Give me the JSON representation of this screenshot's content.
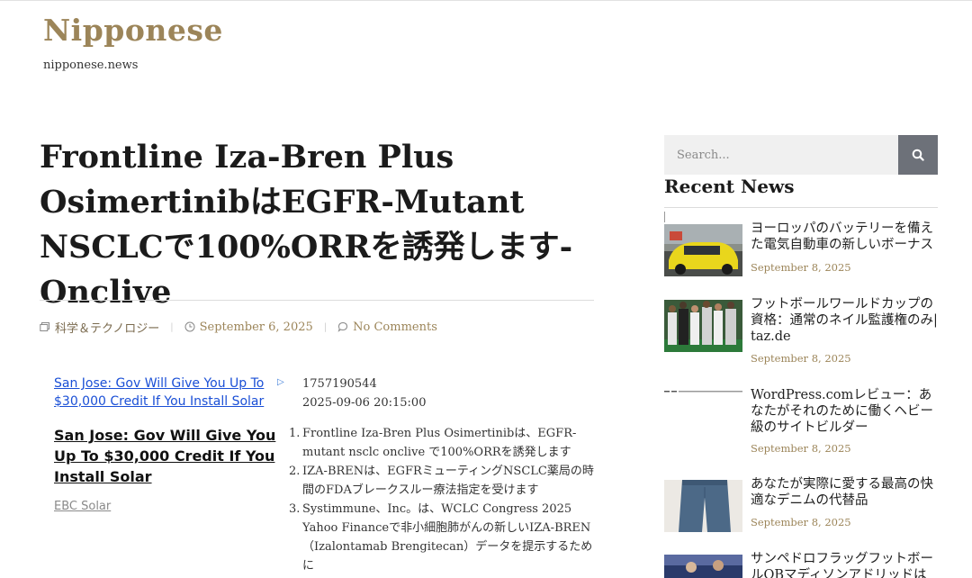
{
  "site": {
    "title": "Nipponese",
    "tagline": "nipponese.news"
  },
  "post": {
    "title": "Frontline Iza-Bren Plus OsimertinibはEGFR-Mutant NSCLCで100%ORRを誘発します-Onclive",
    "category": "科学＆テクノロジー",
    "date": "September 6, 2025",
    "comments": "No Comments"
  },
  "ad": {
    "image_alt": "San Jose: Gov Will Give You Up To $30,000 Credit If You Install Solar",
    "marker": "▷",
    "headline": "San Jose: Gov Will Give You Up To $30,000 Credit If You Install Solar",
    "source": "EBC Solar"
  },
  "body": {
    "id_line": "1757190544",
    "timestamp": "2025-09-06 20:15:00",
    "points": [
      {
        "num": "1.",
        "text": "Frontline Iza-Bren Plus Osimertinibは、EGFR-mutant nsclc onclive で100%ORRを誘発します"
      },
      {
        "num": "2.",
        "text": "IZA-BRENは、EGFRミューティングNSCLC薬局の時間のFDAブレークスルー療法指定を受けます"
      },
      {
        "num": "3.",
        "text": "Systimmune、Inc。は、WCLC Congress 2025 Yahoo Financeで非小細胞肺がんの新しいIZA-BREN（Izalontamab Brengitecan）データを提示するために"
      }
    ]
  },
  "sidebar": {
    "search_placeholder": "Search...",
    "recent_title": "Recent News",
    "items": [
      {
        "title": "ヨーロッパのバッテリーを備えた電気自動車の新しいボーナス",
        "date": "September 8, 2025"
      },
      {
        "title": "フットボールワールドカップの資格：通常のネイル監護権のみ| taz.de",
        "date": "September 8, 2025"
      },
      {
        "title": "WordPress.comレビュー：あなたがそれのために働くヘビー級のサイトビルダー",
        "date": "September 8, 2025"
      },
      {
        "title": "あなたが実際に愛する最高の快適なデニムの代替品",
        "date": "September 8, 2025"
      },
      {
        "title": "サンペドロフラッグフットボールQBマディソンアドリッドは",
        "date": ""
      }
    ]
  },
  "colors": {
    "accent": "#9c8559",
    "search_button": "#6d7179",
    "link_blue": "#1a4fd6"
  }
}
